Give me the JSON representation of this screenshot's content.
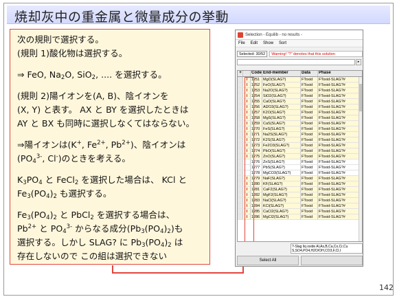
{
  "slide": {
    "title": "焼却灰中の重金属と微量成分の挙動",
    "page_number": "142"
  },
  "textbox": {
    "lines": {
      "l1": "次の規則で選択する。",
      "l2": "(規則 1)酸化物は選択する。",
      "l3a": "⇒ FeO, Na",
      "l3b": "2",
      "l3c": "O, SiO",
      "l3d": "2",
      "l3e": ", .... を選択する。",
      "l4": "(規則 2)陽イオンを(A, B)、陰イオンを",
      "l5": "(X, Y) と表す。 AX と BY を選択したときは",
      "l6": "AY と BX も同時に選択しなくてはならない。",
      "l7a": "⇒陽イオンは(K",
      "l7b": "+",
      "l7c": ", Fe",
      "l7d": "2+",
      "l7e": ", Pb",
      "l7f": "2+",
      "l7g": ")、陰イオンは",
      "l8a": "(PO",
      "l8b": "4",
      "l8c": "3-",
      "l8d": ", Cl",
      "l8e": "-",
      "l8f": ")のときを考える。",
      "l9a": "K",
      "l9b": "3",
      "l9c": "PO",
      "l9d": "4",
      "l9e": " と FeCl",
      "l9f": "2",
      "l9g": " を選択した場合は、 KCl と",
      "l10a": "Fe",
      "l10b": "3",
      "l10c": "(PO",
      "l10d": "4",
      "l10e": ")",
      "l10f": "2",
      "l10g": " も選択する。",
      "l11a": "Fe",
      "l11b": "3",
      "l11c": "(PO",
      "l11d": "4",
      "l11e": ")",
      "l11f": "2",
      "l11g": " と PbCl",
      "l11h": "2",
      "l11i": " を選択する場合は、",
      "l12a": "Pb",
      "l12b": "2+",
      "l12c": " と PO",
      "l12d": "4",
      "l12e": "3-",
      "l12f": " からなる成分(Pb",
      "l12g": "3",
      "l12h": "(PO",
      "l12i": "4",
      "l12j": ")",
      "l12k": "2",
      "l12l": ")も",
      "l13a": "選択する。しかし SLAG? に Pb",
      "l13b": "3",
      "l13c": "(PO",
      "l13d": "4",
      "l13e": ")",
      "l13f": "2",
      "l13g": " は",
      "l14": "存在しないので この組は選択できない"
    }
  },
  "window": {
    "title": "Selection - Equilib   - no results -",
    "menu": [
      "File",
      "Edit",
      "Show",
      "Sort"
    ],
    "selected_count": "Selected: 30/52",
    "warning": "Warning!  \"?\" denotes that this solution",
    "columns": [
      "+",
      "",
      "Code",
      "End-member",
      "Data",
      "Phase"
    ],
    "rows": [
      {
        "mark": "I",
        "code": "1251",
        "end": "MgO(SLAG?)",
        "data": "FToxid",
        "phase": "FToxid-SLAG?#",
        "sel": true
      },
      {
        "mark": "I",
        "code": "1252",
        "end": "FeO(SLAG?)",
        "data": "FToxid",
        "phase": "FToxid-SLAG?#",
        "sel": true
      },
      {
        "mark": "I",
        "code": "1253",
        "end": "Na2O(SLAG?)",
        "data": "FToxid",
        "phase": "FToxid-SLAG?#",
        "sel": true
      },
      {
        "mark": "I",
        "code": "1254",
        "end": "SiO2(SLAG?)",
        "data": "FToxid",
        "phase": "FToxid-SLAG?#",
        "sel": true
      },
      {
        "mark": "I",
        "code": "1255",
        "end": "CaO(SLAG?)",
        "data": "FToxid",
        "phase": "FToxid-SLAG?#",
        "sel": true
      },
      {
        "mark": "I",
        "code": "1256",
        "end": "Al2O3(SLAG?)",
        "data": "FToxid",
        "phase": "FToxid-SLAG?#",
        "sel": true
      },
      {
        "mark": "I",
        "code": "1257",
        "end": "K2O(SLAG?)",
        "data": "FToxid",
        "phase": "FToxid-SLAG?#",
        "sel": true
      },
      {
        "mark": "I",
        "code": "1258",
        "end": "MgS(SLAG?)",
        "data": "FToxid",
        "phase": "FToxid-SLAG?#",
        "sel": true
      },
      {
        "mark": "I",
        "code": "1259",
        "end": "CaS(SLAG?)",
        "data": "FToxid",
        "phase": "FToxid-SLAG?#",
        "sel": true
      },
      {
        "mark": "I",
        "code": "1270",
        "end": "FeS(SLAG?)",
        "data": "FToxid",
        "phase": "FToxid-SLAG?#",
        "sel": true
      },
      {
        "mark": "I",
        "code": "1271",
        "end": "Na2S(SLAG?)",
        "data": "FToxid",
        "phase": "FToxid-SLAG?#",
        "sel": true
      },
      {
        "mark": "I",
        "code": "1272",
        "end": "K2S(SLAG?)",
        "data": "FToxid",
        "phase": "FToxid-SLAG?#",
        "sel": true
      },
      {
        "mark": "I",
        "code": "1273",
        "end": "Fe2O3(SLAG?)",
        "data": "FToxid",
        "phase": "FToxid-SLAG?#",
        "sel": true
      },
      {
        "mark": "I",
        "code": "1274",
        "end": "PbO(SLAG?)",
        "data": "FToxid",
        "phase": "FToxid-SLAG?#",
        "sel": true
      },
      {
        "mark": "I",
        "code": "1275",
        "end": "ZnO(SLAG?)",
        "data": "FToxid",
        "phase": "FToxid-SLAG?#",
        "sel": true
      },
      {
        "mark": "",
        "code": "1276",
        "end": "ZnS(SLAG?)",
        "data": "FToxid",
        "phase": "FToxid-SLAG?#",
        "sel": false
      },
      {
        "mark": "",
        "code": "1277",
        "end": "PbS(SLAG?)",
        "data": "FToxid",
        "phase": "FToxid-SLAG?#",
        "sel": false
      },
      {
        "mark": "",
        "code": "1278",
        "end": "MgCO3(SLAG?)",
        "data": "FToxid",
        "phase": "FToxid-SLAG?#",
        "sel": false
      },
      {
        "mark": "I",
        "code": "1279",
        "end": "NaF(SLAG?)",
        "data": "FToxid",
        "phase": "FToxid-SLAG?#",
        "sel": true
      },
      {
        "mark": "I",
        "code": "1280",
        "end": "KF(SLAG?)",
        "data": "FToxid",
        "phase": "FToxid-SLAG?#",
        "sel": true
      },
      {
        "mark": "I",
        "code": "1281",
        "end": "CaF2(SLAG?)",
        "data": "FToxid",
        "phase": "FToxid-SLAG?#",
        "sel": true
      },
      {
        "mark": "I",
        "code": "1282",
        "end": "MgF2(SLAG?)",
        "data": "FToxid",
        "phase": "FToxid-SLAG?#",
        "sel": true
      },
      {
        "mark": "I",
        "code": "1283",
        "end": "NaCl(SLAG?)",
        "data": "FToxid",
        "phase": "FToxid-SLAG?#",
        "sel": true
      },
      {
        "mark": "I",
        "code": "1284",
        "end": "KCl(SLAG?)",
        "data": "FToxid",
        "phase": "FToxid-SLAG?#",
        "sel": true
      },
      {
        "mark": "I",
        "code": "1285",
        "end": "CaCl2(SLAG?)",
        "data": "FToxid",
        "phase": "FToxid-SLAG?#",
        "sel": true
      },
      {
        "mark": "I",
        "code": "1286",
        "end": "MgCl2(SLAG?)",
        "data": "FToxid",
        "phase": "FToxid-SLAG?#",
        "sel": true
      }
    ],
    "species_line1": "?-Slag liq oxide Al,As,B,Ca,Co,Cr,Cu",
    "species_line2": "S,SO4,PO4,H2O/OH,CO3,F,Cl,I",
    "buttons": [
      "Select All",
      ""
    ]
  },
  "colors": {
    "accent_red": "#e0463c",
    "textbox_bg": "#fff7dc",
    "title_band": "#d3d9ff"
  }
}
